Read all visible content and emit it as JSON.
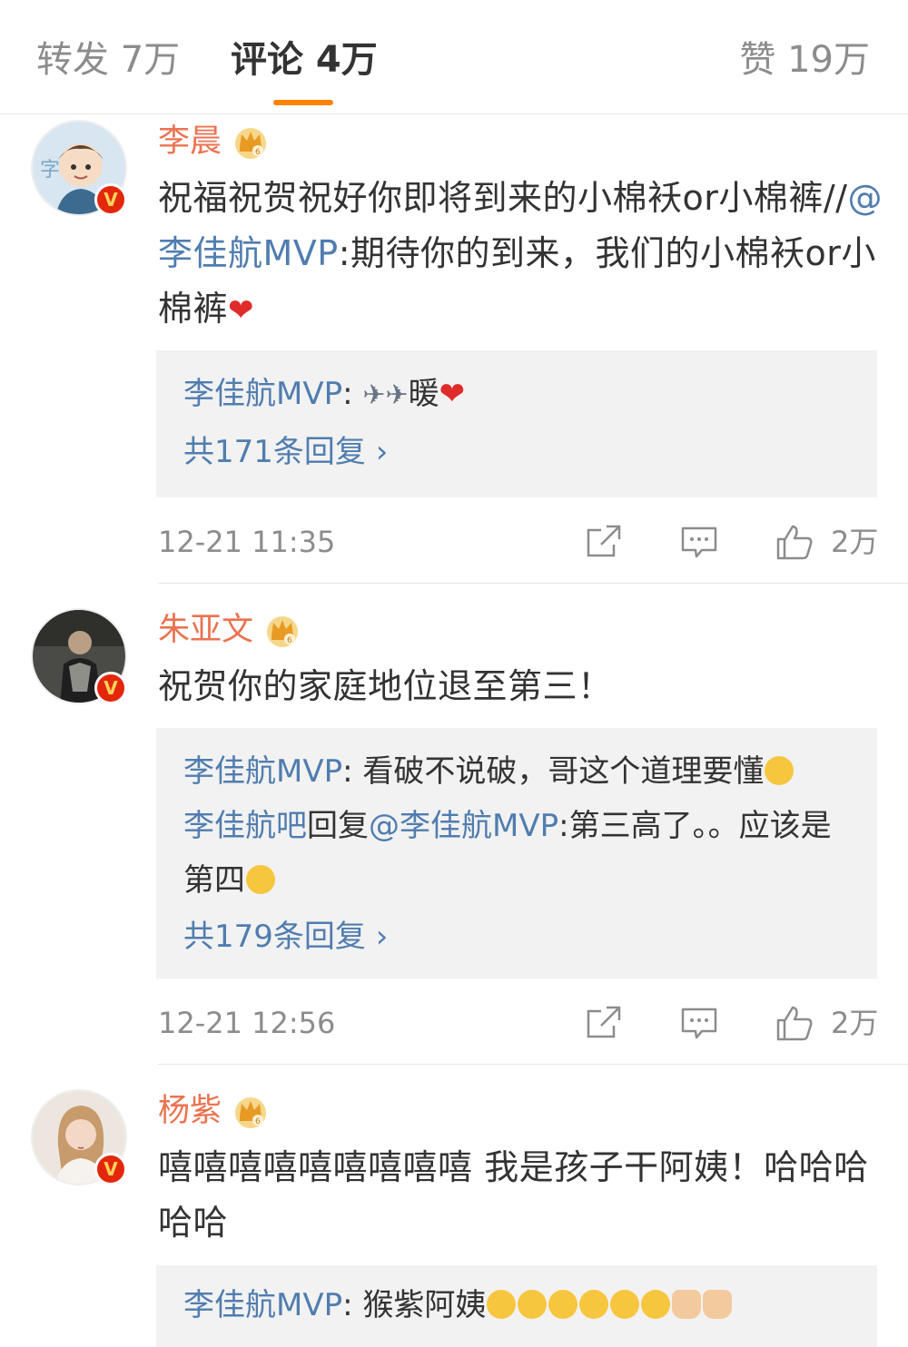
{
  "tabs": {
    "repost": "转发 7万",
    "comments": "评论 4万",
    "likes": "赞 19万"
  },
  "colors": {
    "accent": "#ff8200",
    "username": "#eb7350",
    "link": "#507daf",
    "vip": "#e3270c"
  },
  "comments": [
    {
      "user": "李晨",
      "text_a": "祝福祝贺祝好你即将到来的小棉袄or小棉裤//",
      "mention": "@李佳航MVP",
      "text_b": ":期待你的到来，我们的小棉袄or小棉裤",
      "replies": [
        {
          "user": "李佳航MVP",
          "text_a": ": ",
          "text_b": "暖"
        }
      ],
      "more": "共171条回复",
      "time": "12-21 11:35",
      "likes": "2万"
    },
    {
      "user": "朱亚文",
      "text": "祝贺你的家庭地位退至第三！",
      "replies": [
        {
          "user": "李佳航MVP",
          "text": ": 看破不说破，哥这个道理要懂"
        },
        {
          "user": "李佳航吧",
          "mid": "回复",
          "mention": "@李佳航MVP",
          "text": ":第三高了。。应该是第四"
        }
      ],
      "more": "共179条回复",
      "time": "12-21 12:56",
      "likes": "2万"
    },
    {
      "user": "杨紫",
      "text": "嘻嘻嘻嘻嘻嘻嘻嘻嘻 我是孩子干阿姨！哈哈哈哈哈",
      "replies": [
        {
          "user": "李佳航MVP",
          "text": ": 猴紫阿姨"
        }
      ]
    }
  ]
}
